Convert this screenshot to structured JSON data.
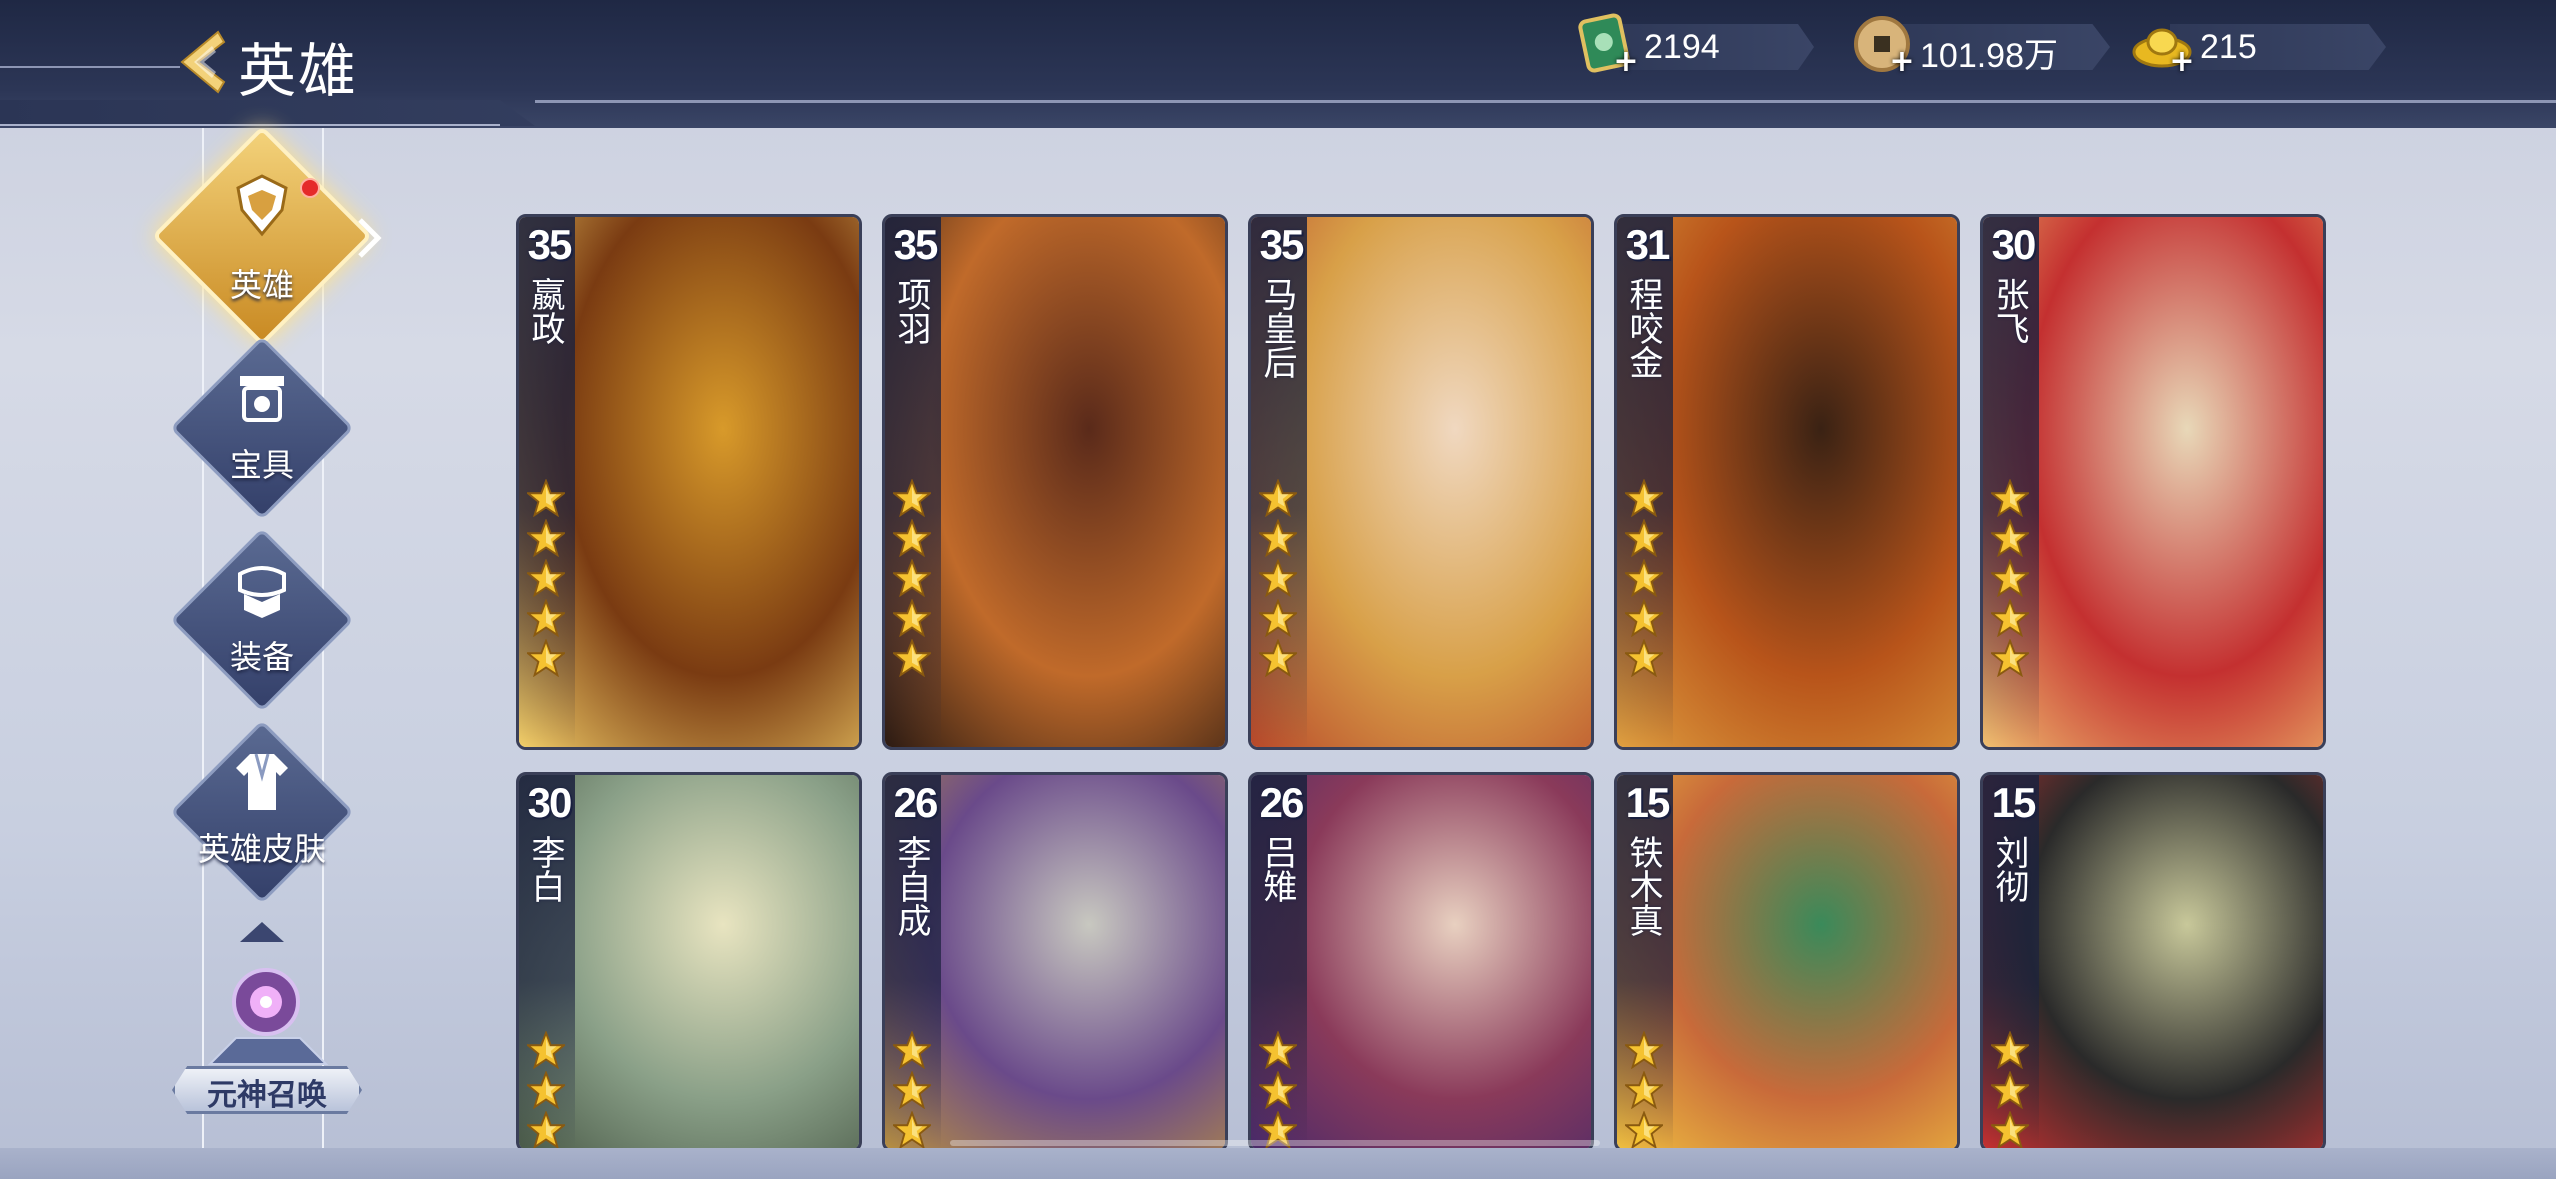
{
  "header": {
    "title": "英雄",
    "currencies": [
      {
        "icon": "jade-ticket-icon",
        "value": "2194"
      },
      {
        "icon": "copper-coin-icon",
        "value": "101.98万"
      },
      {
        "icon": "gold-ingot-icon",
        "value": "215"
      }
    ]
  },
  "sidebar": {
    "items": [
      {
        "label": "英雄",
        "icon": "hero-helmet-icon",
        "active": true,
        "badge": true
      },
      {
        "label": "宝具",
        "icon": "treasure-icon",
        "active": false
      },
      {
        "label": "装备",
        "icon": "armor-icon",
        "active": false
      },
      {
        "label": "英雄皮肤",
        "icon": "robe-icon",
        "active": false
      }
    ],
    "summon": {
      "label": "元神召唤",
      "icon": "spirit-gem-icon"
    }
  },
  "heroes": [
    {
      "level": "35",
      "name": "嬴政",
      "stars": 5,
      "palette": [
        "#d89a2a",
        "#7a3b12",
        "#f3d06a"
      ]
    },
    {
      "level": "35",
      "name": "项羽",
      "stars": 5,
      "palette": [
        "#5a2a1a",
        "#c06a2a",
        "#2b1a12"
      ]
    },
    {
      "level": "35",
      "name": "马皇后",
      "stars": 5,
      "palette": [
        "#f0d8c0",
        "#d8a048",
        "#b8482a"
      ]
    },
    {
      "level": "31",
      "name": "程咬金",
      "stars": 5,
      "palette": [
        "#3a2214",
        "#b8541a",
        "#e0a040"
      ]
    },
    {
      "level": "30",
      "name": "张飞",
      "stars": 5,
      "palette": [
        "#e8d8b8",
        "#c43030",
        "#f0c070"
      ]
    },
    {
      "level": "30",
      "name": "李白",
      "stars": 3,
      "palette": [
        "#e8e4c0",
        "#8aa088",
        "#4a5a48"
      ]
    },
    {
      "level": "26",
      "name": "李自成",
      "stars": 3,
      "palette": [
        "#c8c8c0",
        "#6a4a8a",
        "#b89040"
      ]
    },
    {
      "level": "26",
      "name": "吕雉",
      "stars": 3,
      "palette": [
        "#e8d0c0",
        "#8a3a5a",
        "#4a2a6a"
      ]
    },
    {
      "level": "15",
      "name": "铁木真",
      "stars": 3,
      "palette": [
        "#3a8a5a",
        "#c86a3a",
        "#f0c040"
      ]
    },
    {
      "level": "15",
      "name": "刘彻",
      "stars": 3,
      "palette": [
        "#c8c89a",
        "#2a2a2a",
        "#c83030"
      ]
    }
  ],
  "colors": {
    "accent_gold": "#f3d27a",
    "nav_blue": "#34406a",
    "badge_red": "#e52a2a"
  }
}
